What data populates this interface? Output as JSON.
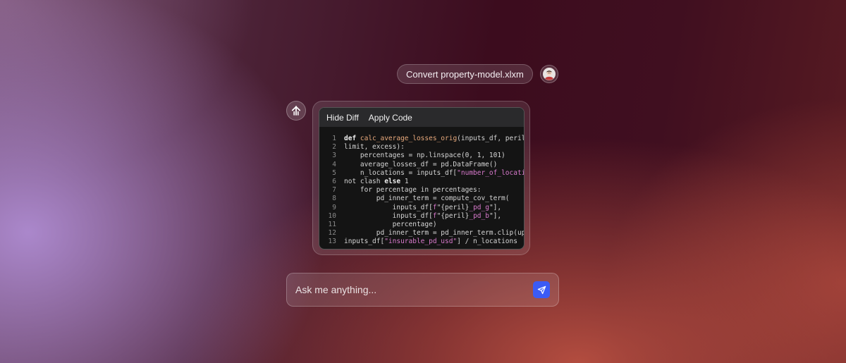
{
  "user_message": {
    "text": "Convert property-model.xlxm"
  },
  "code_panel": {
    "hide_diff_label": "Hide Diff",
    "apply_code_label": "Apply Code",
    "lines": [
      {
        "n": "1",
        "parts": [
          {
            "t": "def ",
            "c": "kw"
          },
          {
            "t": "calc_average_losses_orig",
            "c": "fn"
          },
          {
            "t": "(inputs_df, peril,",
            "c": ""
          }
        ]
      },
      {
        "n": "2",
        "parts": [
          {
            "t": "limit, excess):",
            "c": ""
          }
        ]
      },
      {
        "n": "3",
        "parts": [
          {
            "t": "    percentages = np.linspace(0, 1, 101)",
            "c": ""
          }
        ]
      },
      {
        "n": "4",
        "parts": [
          {
            "t": "    average_losses_df = pd.DataFrame()",
            "c": ""
          }
        ]
      },
      {
        "n": "5",
        "parts": [
          {
            "t": "    n_locations = inputs_df[",
            "c": ""
          },
          {
            "t": "\"number_of_locatio",
            "c": "str"
          }
        ]
      },
      {
        "n": "6",
        "parts": [
          {
            "t": "not clash ",
            "c": ""
          },
          {
            "t": "else",
            "c": "kw"
          },
          {
            "t": " 1",
            "c": ""
          }
        ]
      },
      {
        "n": "7",
        "parts": [
          {
            "t": "    for percentage in percentages:",
            "c": ""
          }
        ]
      },
      {
        "n": "8",
        "parts": [
          {
            "t": "        pd_inner_term = compute_cov_term(",
            "c": ""
          }
        ]
      },
      {
        "n": "9",
        "parts": [
          {
            "t": "            inputs_df[",
            "c": ""
          },
          {
            "t": "f",
            "c": "str"
          },
          {
            "t": "\"{peril}",
            "c": ""
          },
          {
            "t": "_pd_g",
            "c": "str"
          },
          {
            "t": "\"],",
            "c": ""
          }
        ]
      },
      {
        "n": "10",
        "parts": [
          {
            "t": "            inputs_df[",
            "c": ""
          },
          {
            "t": "f",
            "c": "str"
          },
          {
            "t": "\"{peril}",
            "c": ""
          },
          {
            "t": "_pd_b",
            "c": "str"
          },
          {
            "t": "\"],",
            "c": ""
          }
        ]
      },
      {
        "n": "11",
        "parts": [
          {
            "t": "            percentage)",
            "c": ""
          }
        ]
      },
      {
        "n": "12",
        "parts": [
          {
            "t": "        pd_inner_term = pd_inner_term.clip(upp",
            "c": ""
          }
        ]
      },
      {
        "n": "13",
        "parts": [
          {
            "t": "inputs_df[",
            "c": ""
          },
          {
            "t": "\"insurable_pd_usd\"",
            "c": "str"
          },
          {
            "t": "] / n_locations",
            "c": ""
          }
        ]
      }
    ]
  },
  "chat_input": {
    "placeholder": "Ask me anything..."
  },
  "icons": {
    "avatar": "user-avatar",
    "assistant": "assistant-logo-icon",
    "send": "paper-plane-icon"
  },
  "colors": {
    "send_button": "#3b5bf5",
    "code_function": "#e8a97c",
    "code_string": "#d879cc"
  }
}
